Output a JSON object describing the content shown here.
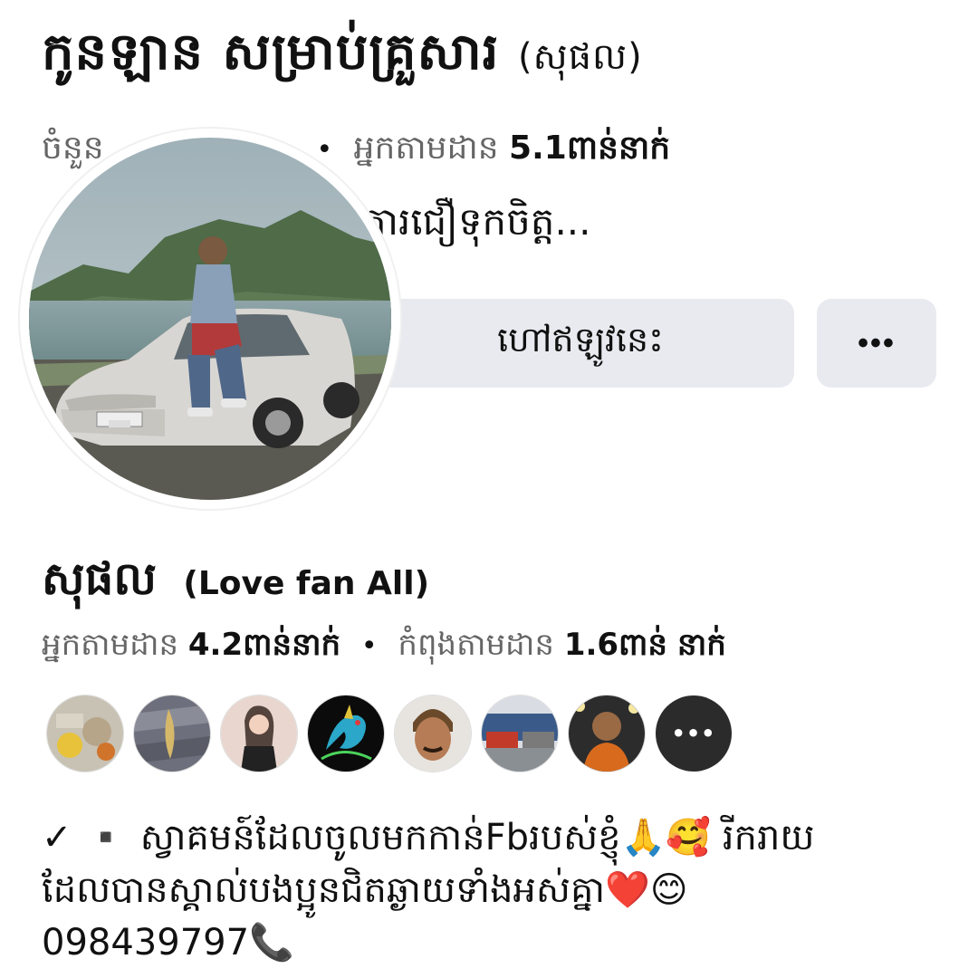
{
  "header": {
    "title": "កូនឡាន សម្រាប់គ្រួសារ",
    "title_suffix": "(សុផល)",
    "stats_prefix": "ចំនួន",
    "followers_label": "អ្នកតាមដាន",
    "followers_value": "5.1ពាន់នាក់",
    "intro_text": "ការជឿទុកចិត្ត..."
  },
  "actions": {
    "call_label": "ហៅឥឡូវនេះ",
    "more_label": "•••"
  },
  "profile": {
    "name": "សុផល",
    "name_sub": "(Love fan All)",
    "followers_label": "អ្នកតាមដាន",
    "followers_value": "4.2ពាន់នាក់",
    "following_label": "កំពុងតាមដាន",
    "following_value": "1.6ពាន់",
    "following_unit": "នាក់"
  },
  "friends": {
    "more_label": "•••",
    "avatars": [
      "food",
      "object",
      "woman",
      "dragon",
      "man",
      "trucks",
      "monk"
    ]
  },
  "bio": {
    "line1": "✓ ▪️ ស្វាគមន៍ដែលចូលមកកាន់Fbរបស់ខ្ញុំ🙏🥰 រីករាយ",
    "line2": "ដែលបានស្គាល់បងប្អូនជិតឆ្ងាយទាំងអស់គ្នា❤️😊",
    "line3": "098439797📞"
  },
  "colors": {
    "button_bg": "#e9eaf0",
    "muted_text": "#666666",
    "text": "#111111"
  }
}
